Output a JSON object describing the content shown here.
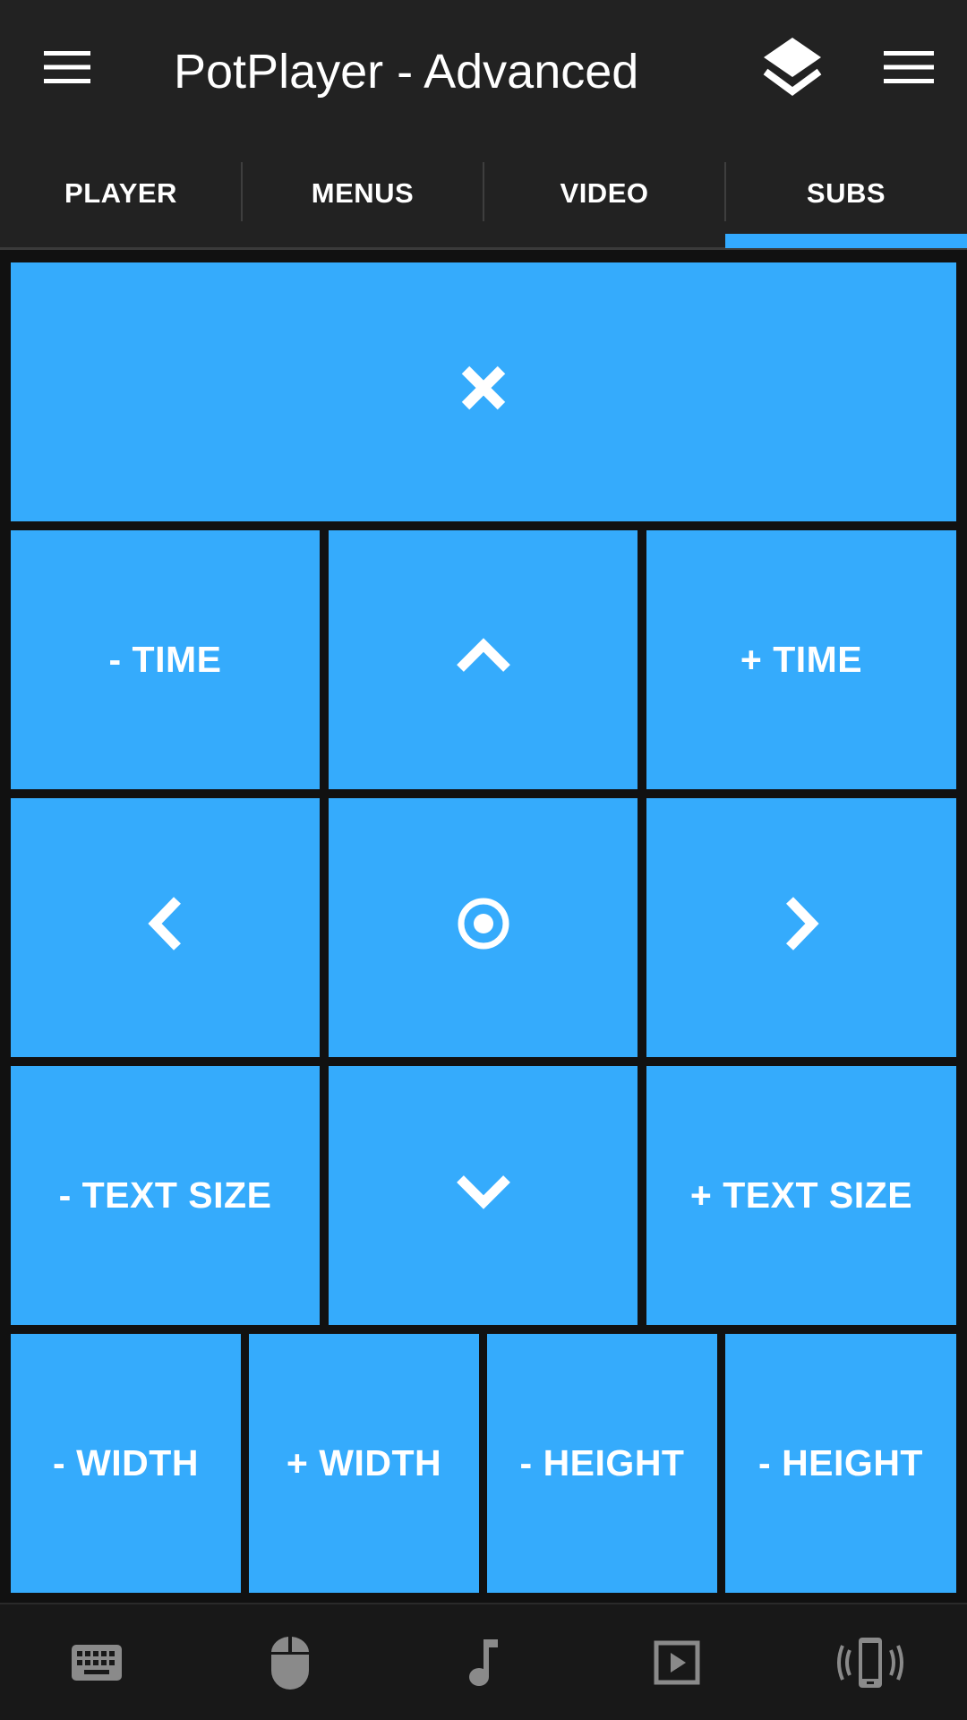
{
  "app": {
    "title": "PotPlayer - Advanced",
    "left_menu_icon": "hamburger-menu-icon",
    "layers_icon": "layers-icon",
    "right_menu_icon": "hamburger-menu-icon"
  },
  "tabs": [
    {
      "label": "PLAYER",
      "active": false
    },
    {
      "label": "MENUS",
      "active": false
    },
    {
      "label": "VIDEO",
      "active": false
    },
    {
      "label": "SUBS",
      "active": true
    }
  ],
  "controls": {
    "close_icon": "close-icon",
    "minus_time": "- TIME",
    "up_icon": "chevron-up-icon",
    "plus_time": "+ TIME",
    "left_icon": "chevron-left-icon",
    "center_icon": "target-icon",
    "right_icon": "chevron-right-icon",
    "minus_text_size": "- TEXT SIZE",
    "down_icon": "chevron-down-icon",
    "plus_text_size": "+ TEXT SIZE",
    "minus_width": "- WIDTH",
    "plus_width": "+ WIDTH",
    "minus_height": "- HEIGHT",
    "minus_height_2": "- HEIGHT"
  },
  "bottom_nav": [
    {
      "icon": "keyboard-icon"
    },
    {
      "icon": "mouse-icon"
    },
    {
      "icon": "music-note-icon"
    },
    {
      "icon": "play-box-icon"
    },
    {
      "icon": "phone-vibrate-icon"
    }
  ],
  "colors": {
    "accent": "#33aaff",
    "button": "#35abfc",
    "appbar": "#222222",
    "background": "#111111",
    "bottom_icons": "#8a8a8a"
  }
}
